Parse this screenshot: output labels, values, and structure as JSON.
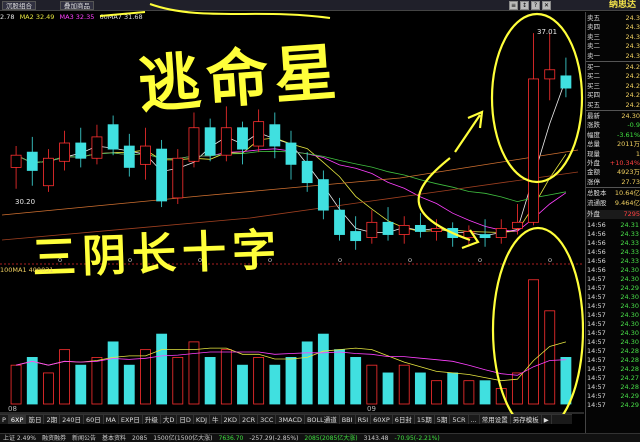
{
  "window": {
    "tabs": [
      "沉股组合",
      "叠加商品"
    ],
    "title": "纳思达",
    "controls": [
      "≡",
      "↕",
      "?",
      "✕"
    ]
  },
  "ma_line": {
    "items": [
      {
        "text": "2.78",
        "color": "#e8e8e8"
      },
      {
        "text": "MA2 32.49",
        "color": "#e6e640"
      },
      {
        "text": "MA3 32.35",
        "color": "#ff40ff"
      },
      {
        "text": "60MA7 31.68",
        "color": "#dddddd"
      }
    ]
  },
  "chart": {
    "low_label": "30.20",
    "high_label": "37.01",
    "x_labels": [
      "08",
      "09"
    ]
  },
  "annotations": {
    "line1": "逃命星",
    "line2": "三阴长十字"
  },
  "volume_label": "100MA1 400031",
  "bottom_tabs": [
    "P",
    "6XP",
    "筋日",
    "2期",
    "240日",
    "60日",
    "MA",
    "EXP日",
    "升级",
    "大D",
    "日D",
    "KDJ",
    "牛",
    "2KD",
    "2CR",
    "3CC",
    "3MACD",
    "BOLL通道",
    "BBI",
    "RSI",
    "60XP",
    "6日封",
    "15期",
    "5期",
    "5CR",
    "...",
    "常用设置",
    "另存模板",
    "▶"
  ],
  "statusbar": {
    "items": [
      "上证 2.49%",
      "融资融券",
      "新闻公告",
      "基本资料",
      "2085",
      "1500亿(1500亿大涨)",
      "7636.70",
      "-257.29(-2.85%)",
      "2085(2085亿大涨)",
      "3143.48",
      "-70.95(-2.21%)"
    ]
  },
  "quote_panel": {
    "rows": [
      {
        "label": "卖五",
        "value": "24.3"
      },
      {
        "label": "卖四",
        "value": "24.3"
      },
      {
        "label": "卖三",
        "value": "24.3"
      },
      {
        "label": "卖二",
        "value": "24.3"
      },
      {
        "label": "卖一",
        "value": "24.3"
      },
      {
        "label": "买一",
        "value": "24.2"
      },
      {
        "label": "买二",
        "value": "24.2"
      },
      {
        "label": "买三",
        "value": "24.2"
      },
      {
        "label": "买四",
        "value": "24.2"
      },
      {
        "label": "买五",
        "value": "24.2"
      },
      {
        "label": "最新",
        "value": "24.30"
      },
      {
        "label": "涨跌",
        "value": "-0.9"
      },
      {
        "label": "幅度",
        "value": "-3.61%"
      },
      {
        "label": "总量",
        "value": "2011万"
      },
      {
        "label": "现量",
        "value": "1"
      },
      {
        "label": "外盘",
        "value": "+10.34%"
      },
      {
        "label": "金额",
        "value": "4923万"
      },
      {
        "label": "涨停",
        "value": "27.73"
      },
      {
        "label": "总股本",
        "value": "10.64亿"
      },
      {
        "label": "流通股",
        "value": "9.464亿"
      }
    ],
    "outer_label": "外盘",
    "outer_value": "7295",
    "ticks": [
      {
        "time": "14:56",
        "price": "24.31"
      },
      {
        "time": "14:56",
        "price": "24.33"
      },
      {
        "time": "14:56",
        "price": "24.33"
      },
      {
        "time": "14:56",
        "price": "24.33"
      },
      {
        "time": "14:56",
        "price": "24.33"
      },
      {
        "time": "14:56",
        "price": "24.30"
      },
      {
        "time": "14:57",
        "price": "24.30"
      },
      {
        "time": "14:57",
        "price": "24.29"
      },
      {
        "time": "14:57",
        "price": "24.30"
      },
      {
        "time": "14:57",
        "price": "24.30"
      },
      {
        "time": "14:57",
        "price": "24.30"
      },
      {
        "time": "14:57",
        "price": "24.30"
      },
      {
        "time": "14:57",
        "price": "24.30"
      },
      {
        "time": "14:57",
        "price": "24.30"
      },
      {
        "time": "14:57",
        "price": "24.28"
      },
      {
        "time": "14:57",
        "price": "24.28"
      },
      {
        "time": "14:57",
        "price": "24.28"
      },
      {
        "time": "14:57",
        "price": "24.27"
      },
      {
        "time": "14:57",
        "price": "24.28"
      },
      {
        "time": "14:57",
        "price": "24.29"
      },
      {
        "time": "14:57",
        "price": "24.29"
      }
    ]
  },
  "candles": [
    {
      "o": 32.6,
      "c": 33.0,
      "h": 33.3,
      "l": 31.9
    },
    {
      "o": 33.1,
      "c": 32.5,
      "h": 33.6,
      "l": 32.0
    },
    {
      "o": 32.0,
      "c": 32.9,
      "h": 33.2,
      "l": 31.8
    },
    {
      "o": 32.8,
      "c": 33.4,
      "h": 33.8,
      "l": 32.5
    },
    {
      "o": 33.4,
      "c": 32.9,
      "h": 33.9,
      "l": 32.6
    },
    {
      "o": 32.9,
      "c": 33.6,
      "h": 34.0,
      "l": 32.7
    },
    {
      "o": 34.0,
      "c": 33.2,
      "h": 34.3,
      "l": 33.0
    },
    {
      "o": 33.3,
      "c": 32.6,
      "h": 33.7,
      "l": 32.3
    },
    {
      "o": 32.7,
      "c": 33.3,
      "h": 33.9,
      "l": 32.2
    },
    {
      "o": 33.2,
      "c": 31.5,
      "h": 33.5,
      "l": 31.3
    },
    {
      "o": 31.6,
      "c": 32.9,
      "h": 33.2,
      "l": 31.4
    },
    {
      "o": 32.8,
      "c": 33.9,
      "h": 34.4,
      "l": 32.6
    },
    {
      "o": 33.9,
      "c": 33.0,
      "h": 34.2,
      "l": 32.8
    },
    {
      "o": 33.0,
      "c": 33.9,
      "h": 34.6,
      "l": 32.8
    },
    {
      "o": 33.9,
      "c": 33.2,
      "h": 34.1,
      "l": 32.7
    },
    {
      "o": 33.3,
      "c": 34.1,
      "h": 34.5,
      "l": 33.1
    },
    {
      "o": 34.0,
      "c": 33.3,
      "h": 34.4,
      "l": 32.9
    },
    {
      "o": 33.4,
      "c": 32.7,
      "h": 33.8,
      "l": 32.2
    },
    {
      "o": 32.8,
      "c": 32.1,
      "h": 33.1,
      "l": 31.8
    },
    {
      "o": 32.2,
      "c": 31.2,
      "h": 32.5,
      "l": 30.9
    },
    {
      "o": 31.2,
      "c": 30.4,
      "h": 31.6,
      "l": 30.2
    },
    {
      "o": 30.5,
      "c": 30.2,
      "h": 31.0,
      "l": 29.9
    },
    {
      "o": 30.3,
      "c": 30.8,
      "h": 31.2,
      "l": 30.1
    },
    {
      "o": 30.8,
      "c": 30.4,
      "h": 31.3,
      "l": 30.2
    },
    {
      "o": 30.4,
      "c": 30.7,
      "h": 31.0,
      "l": 30.1
    },
    {
      "o": 30.7,
      "c": 30.5,
      "h": 31.1,
      "l": 30.3
    },
    {
      "o": 30.5,
      "c": 30.6,
      "h": 30.9,
      "l": 30.2
    },
    {
      "o": 30.6,
      "c": 30.3,
      "h": 30.8,
      "l": 30.0
    },
    {
      "o": 30.3,
      "c": 30.5,
      "h": 30.7,
      "l": 30.0
    },
    {
      "o": 30.4,
      "c": 30.3,
      "h": 30.9,
      "l": 30.0
    },
    {
      "o": 30.3,
      "c": 30.6,
      "h": 30.9,
      "l": 30.1
    },
    {
      "o": 30.6,
      "c": 30.8,
      "h": 31.4,
      "l": 30.4
    },
    {
      "o": 30.8,
      "c": 35.5,
      "h": 37.0,
      "l": 30.7
    },
    {
      "o": 35.5,
      "c": 35.8,
      "h": 37.01,
      "l": 34.8
    },
    {
      "o": 35.6,
      "c": 35.2,
      "h": 36.2,
      "l": 34.9
    }
  ],
  "volume": [
    5,
    6,
    4,
    7,
    5,
    6,
    8,
    5,
    7,
    9,
    6,
    8,
    6,
    7,
    5,
    6,
    5,
    6,
    8,
    9,
    7,
    6,
    5,
    4,
    5,
    4,
    3,
    4,
    3,
    3,
    2,
    4,
    16,
    12,
    6
  ]
}
